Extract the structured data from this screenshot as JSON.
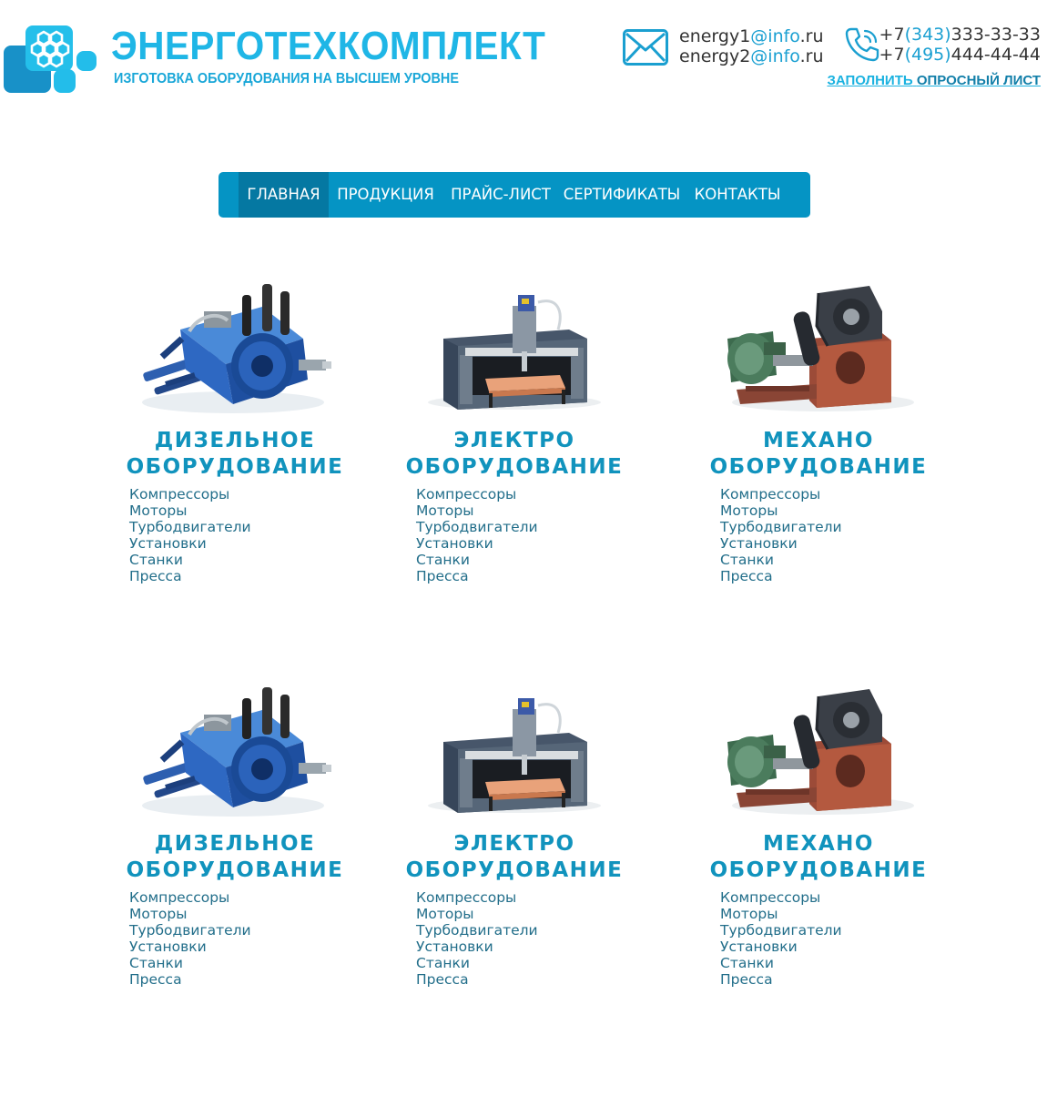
{
  "header": {
    "brand_name": "ЭНЕРГОТЕХКОМПЛЕКТ",
    "tagline": "ИЗГОТОВКА ОБОРУДОВАНИЯ НА ВЫСШЕМ УРОВНЕ",
    "emails": [
      {
        "user": "energy1",
        "domain": "@info",
        "tld": ".ru"
      },
      {
        "user": "energy2",
        "domain": "@info",
        "tld": ".ru"
      }
    ],
    "phones": [
      {
        "prefix": "+7",
        "code": "(343)",
        "number": "333-33-33"
      },
      {
        "prefix": "+7",
        "code": "(495)",
        "number": "444-44-44"
      }
    ],
    "survey_link": {
      "part1": "ЗАПОЛНИТЬ",
      "part2": "ОПРОСНЫЙ ЛИСТ"
    },
    "icons": {
      "mail": "envelope-icon",
      "phone": "phone-icon"
    },
    "colors": {
      "brand": "#1fb6e6",
      "accent": "#1ba0d2"
    }
  },
  "nav": {
    "items": [
      {
        "label": "ГЛАВНАЯ",
        "active": true
      },
      {
        "label": "ПРОДУКЦИЯ",
        "active": false
      },
      {
        "label": "ПРАЙС-ЛИСТ",
        "active": false
      },
      {
        "label": "СЕРТИФИКАТЫ",
        "active": false
      },
      {
        "label": "КОНТАКТЫ",
        "active": false
      }
    ],
    "colors": {
      "bar": "#0594c4",
      "active": "#0578a2"
    }
  },
  "products": [
    {
      "title_line1": "ДИЗЕЛЬНОЕ",
      "title_line2": "ОБОРУДОВАНИЕ",
      "image": "blue-compressor-image",
      "links": [
        "Компрессоры",
        "Моторы",
        "Турбодвигатели",
        "Установки",
        "Станки",
        "Пресса"
      ]
    },
    {
      "title_line1": "ЭЛЕКТРО",
      "title_line2": "ОБОРУДОВАНИЕ",
      "image": "cnc-machine-image",
      "links": [
        "Компрессоры",
        "Моторы",
        "Турбодвигатели",
        "Установки",
        "Станки",
        "Пресса"
      ]
    },
    {
      "title_line1": "МЕХАНО",
      "title_line2": "ОБОРУДОВАНИЕ",
      "image": "motor-gearbox-image",
      "links": [
        "Компрессоры",
        "Моторы",
        "Турбодвигатели",
        "Установки",
        "Станки",
        "Пресса"
      ]
    },
    {
      "title_line1": "ДИЗЕЛЬНОЕ",
      "title_line2": "ОБОРУДОВАНИЕ",
      "image": "blue-compressor-image",
      "links": [
        "Компрессоры",
        "Моторы",
        "Турбодвигатели",
        "Установки",
        "Станки",
        "Пресса"
      ]
    },
    {
      "title_line1": "ЭЛЕКТРО",
      "title_line2": "ОБОРУДОВАНИЕ",
      "image": "cnc-machine-image",
      "links": [
        "Компрессоры",
        "Моторы",
        "Турбодвигатели",
        "Установки",
        "Станки",
        "Пресса"
      ]
    },
    {
      "title_line1": "МЕХАНО",
      "title_line2": "ОБОРУДОВАНИЕ",
      "image": "motor-gearbox-image",
      "links": [
        "Компрессоры",
        "Моторы",
        "Турбодвигатели",
        "Установки",
        "Станки",
        "Пресса"
      ]
    }
  ]
}
